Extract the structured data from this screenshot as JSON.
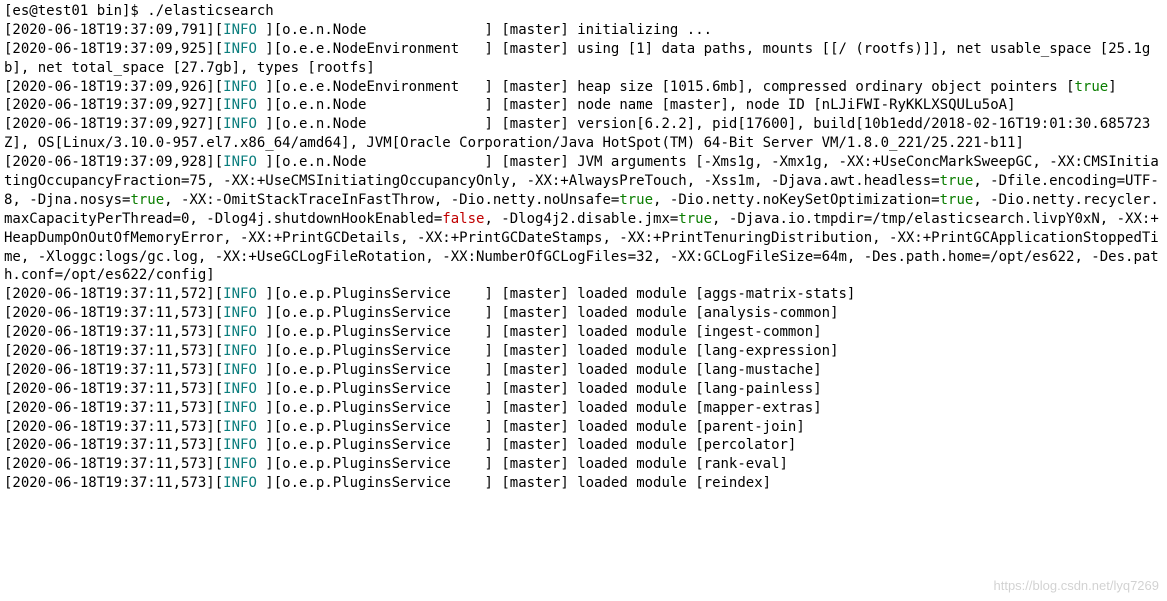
{
  "prompt": {
    "user": "es",
    "host": "test01",
    "cwd": "bin",
    "symbol": "$",
    "command": "./elasticsearch"
  },
  "log_levels": {
    "info": "INFO"
  },
  "bool": {
    "true": "true",
    "false": "false"
  },
  "logs": [
    {
      "ts": "2020-06-18T19:37:09,791",
      "lvl": "INFO",
      "cls": "o.e.n.Node",
      "node": "master",
      "msg": "initializing ..."
    },
    {
      "ts": "2020-06-18T19:37:09,925",
      "lvl": "INFO",
      "cls": "o.e.e.NodeEnvironment",
      "node": "master",
      "msg": "using [1] data paths, mounts [[/ (rootfs)]], net usable_space [25.1gb], net total_space [27.7gb], types [rootfs]"
    },
    {
      "ts": "2020-06-18T19:37:09,926",
      "lvl": "INFO",
      "cls": "o.e.e.NodeEnvironment",
      "node": "master",
      "msg_pre": "heap size [1015.6mb], compressed ordinary object pointers [",
      "msg_bool": "true",
      "msg_post": "]"
    },
    {
      "ts": "2020-06-18T19:37:09,927",
      "lvl": "INFO",
      "cls": "o.e.n.Node",
      "node": "master",
      "msg": "node name [master], node ID [nLJiFWI-RyKKLXSQULu5oA]"
    },
    {
      "ts": "2020-06-18T19:37:09,927",
      "lvl": "INFO",
      "cls": "o.e.n.Node",
      "node": "master",
      "msg": "version[6.2.2], pid[17600], build[10b1edd/2018-02-16T19:01:30.685723Z], OS[Linux/3.10.0-957.el7.x86_64/amd64], JVM[Oracle Corporation/Java HotSpot(TM) 64-Bit Server VM/1.8.0_221/25.221-b11]"
    }
  ],
  "jvm_args_line": {
    "ts": "2020-06-18T19:37:09,928",
    "lvl": "INFO",
    "cls": "o.e.n.Node",
    "node": "master",
    "parts": [
      "JVM arguments [-Xms1g, -Xmx1g, -XX:+UseConcMarkSweepGC, -XX:CMSInitiatingOccupancyFraction=75, -XX:+UseCMSInitiatingOccupancyOnly, -XX:+AlwaysPreTouch, -Xss1m, -Djava.awt.headless=",
      "true",
      ", -Dfile.encoding=UTF-8, -Djna.nosys=",
      "true",
      ", -XX:-OmitStackTraceInFastThrow, -Dio.netty.noUnsafe=",
      "true",
      ", -Dio.netty.noKeySetOptimization=",
      "true",
      ", -Dio.netty.recycler.maxCapacityPerThread=0, -Dlog4j.shutdownHookEnabled=",
      "false",
      ", -Dlog4j2.disable.jmx=",
      "true",
      ", -Djava.io.tmpdir=/tmp/elasticsearch.livpY0xN, -XX:+HeapDumpOnOutOfMemoryError, -XX:+PrintGCDetails, -XX:+PrintGCDateStamps, -XX:+PrintTenuringDistribution, -XX:+PrintGCApplicationStoppedTime, -Xloggc:logs/gc.log, -XX:+UseGCLogFileRotation, -XX:NumberOfGCLogFiles=32, -XX:GCLogFileSize=64m, -Des.path.home=/opt/es622, -Des.path.conf=/opt/es622/config]"
    ],
    "part_is_bool": [
      false,
      true,
      false,
      true,
      false,
      true,
      false,
      true,
      false,
      true,
      false,
      true,
      false
    ]
  },
  "plugins": [
    {
      "ts": "2020-06-18T19:37:11,572",
      "module": "aggs-matrix-stats"
    },
    {
      "ts": "2020-06-18T19:37:11,573",
      "module": "analysis-common"
    },
    {
      "ts": "2020-06-18T19:37:11,573",
      "module": "ingest-common"
    },
    {
      "ts": "2020-06-18T19:37:11,573",
      "module": "lang-expression"
    },
    {
      "ts": "2020-06-18T19:37:11,573",
      "module": "lang-mustache"
    },
    {
      "ts": "2020-06-18T19:37:11,573",
      "module": "lang-painless"
    },
    {
      "ts": "2020-06-18T19:37:11,573",
      "module": "mapper-extras"
    },
    {
      "ts": "2020-06-18T19:37:11,573",
      "module": "parent-join"
    },
    {
      "ts": "2020-06-18T19:37:11,573",
      "module": "percolator"
    },
    {
      "ts": "2020-06-18T19:37:11,573",
      "module": "rank-eval"
    },
    {
      "ts": "2020-06-18T19:37:11,573",
      "module": "reindex"
    }
  ],
  "plugins_meta": {
    "lvl": "INFO",
    "cls": "o.e.p.PluginsService",
    "node": "master",
    "msg_prefix": "loaded module"
  },
  "watermark": "https://blog.csdn.net/lyq7269"
}
